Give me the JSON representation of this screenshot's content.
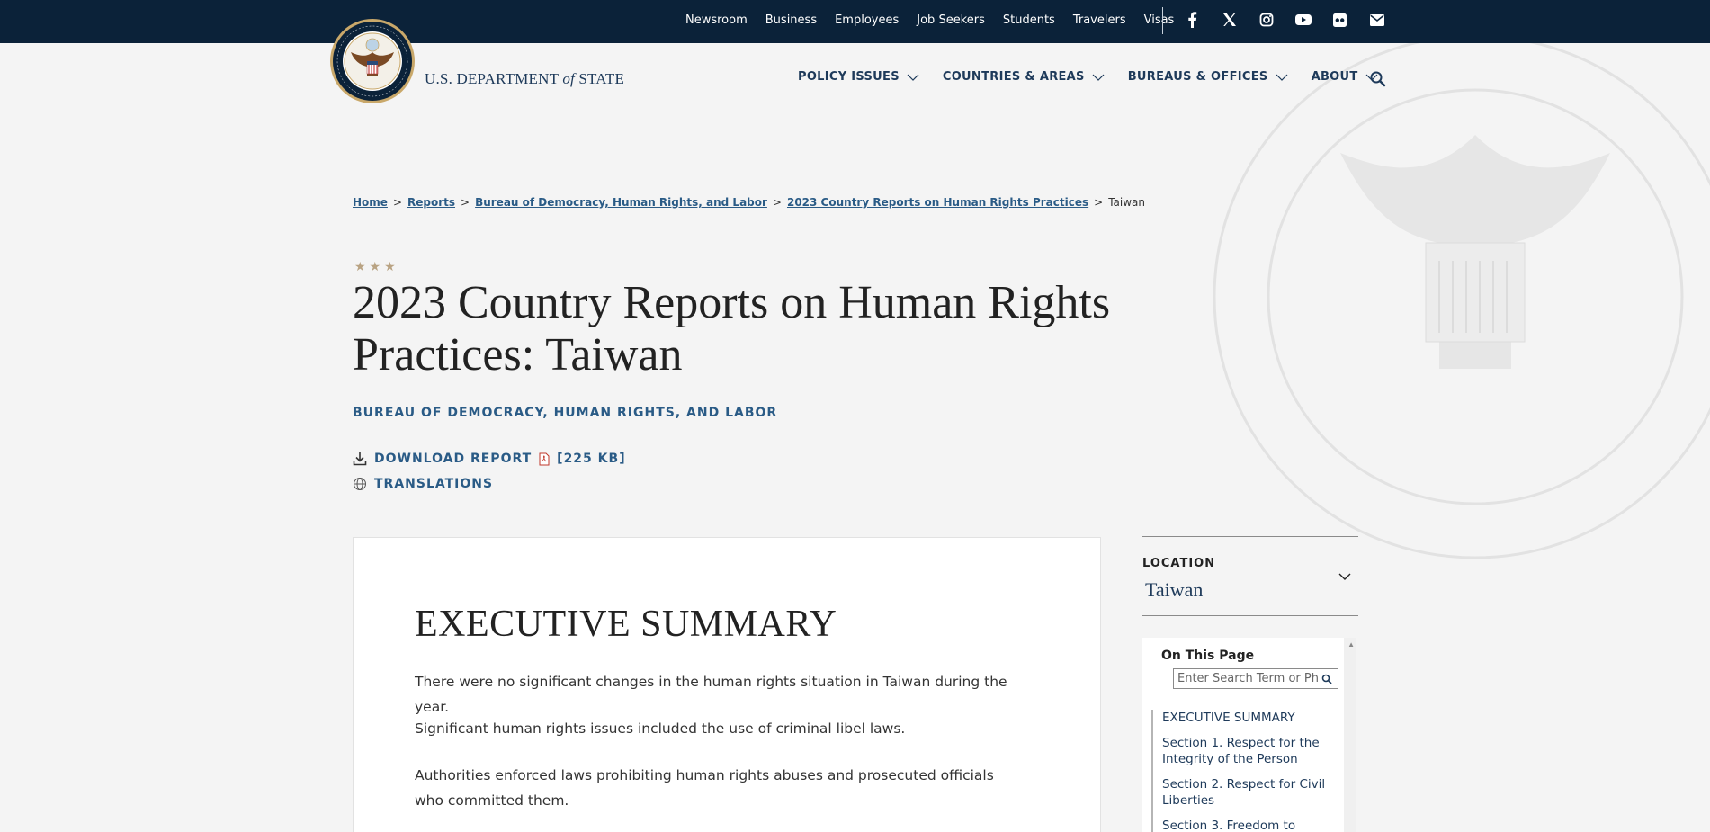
{
  "topbar": {
    "links": [
      "Newsroom",
      "Business",
      "Employees",
      "Job Seekers",
      "Students",
      "Travelers",
      "Visas"
    ],
    "social": [
      "facebook-icon",
      "x-icon",
      "instagram-icon",
      "youtube-icon",
      "flickr-icon",
      "email-icon"
    ]
  },
  "header": {
    "brand_pre": "U.S. DEPARTMENT ",
    "brand_of": "of",
    "brand_post": " STATE",
    "nav": [
      "POLICY ISSUES",
      "COUNTRIES & AREAS",
      "BUREAUS & OFFICES",
      "ABOUT"
    ]
  },
  "breadcrumb": {
    "items": [
      "Home",
      "Reports",
      "Bureau of Democracy, Human Rights, and Labor",
      "2023 Country Reports on Human Rights Practices"
    ],
    "current": "Taiwan",
    "separator": ">"
  },
  "page": {
    "stars": "★★★",
    "title": "2023 Country Reports on Human Rights Practices: Taiwan",
    "bureau": "BUREAU OF DEMOCRACY, HUMAN RIGHTS, AND LABOR",
    "download_label": "DOWNLOAD REPORT",
    "download_size": "[225 KB]",
    "translations_label": "TRANSLATIONS"
  },
  "content": {
    "heading": "EXECUTIVE SUMMARY",
    "paragraphs": [
      "There were no significant changes in the human rights situation in Taiwan during the year.",
      "Significant human rights issues included the use of criminal libel laws.",
      "Authorities enforced laws prohibiting human rights abuses and prosecuted officials who committed them."
    ]
  },
  "sidebar": {
    "location_label": "LOCATION",
    "location_value": "Taiwan",
    "on_this_page": "On This Page",
    "search_placeholder": "Enter Search Term or Phrase",
    "toc": [
      "EXECUTIVE SUMMARY",
      "Section 1. Respect for the Integrity of the Person",
      "Section 2. Respect for Civil Liberties",
      "Section 3. Freedom to"
    ]
  },
  "colors": {
    "topbar_bg": "#0b2239",
    "link_blue": "#2a5b86",
    "navy": "#1e3a5a",
    "gold": "#b9a383"
  }
}
